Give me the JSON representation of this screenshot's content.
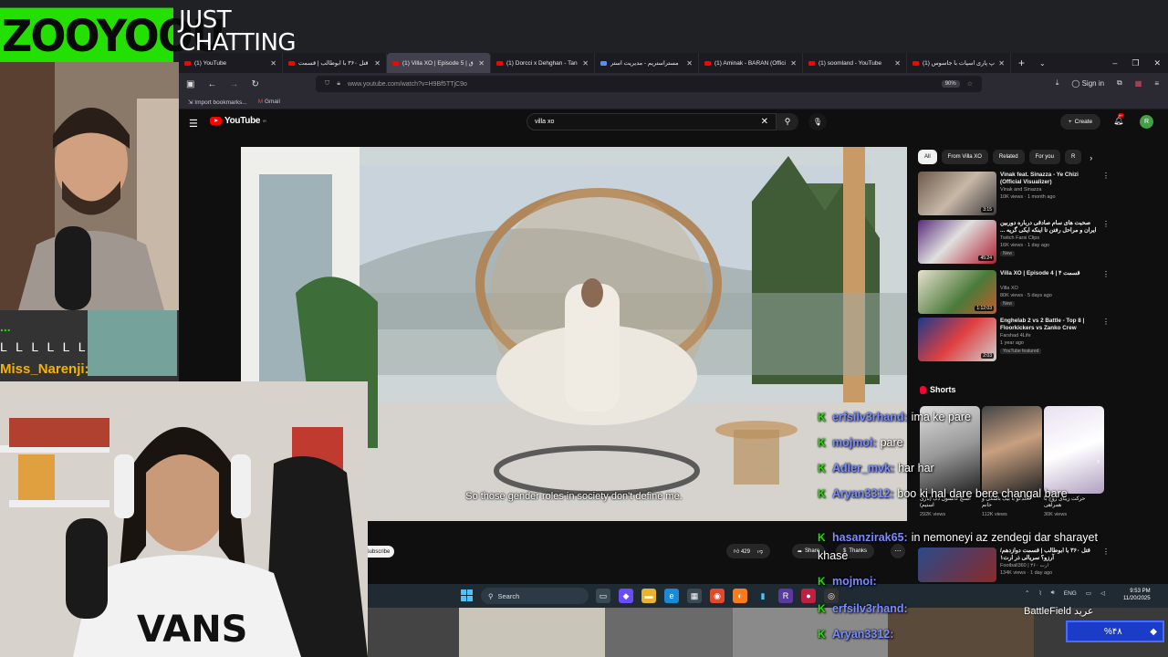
{
  "overlay": {
    "brand": "ZOOYOOU",
    "category_line1": "JUST",
    "category_line2": "CHATTING",
    "chat_strip": {
      "line1": "...",
      "line2": "L L L L L L",
      "line3": "Miss_Narenji:"
    }
  },
  "browser": {
    "tabs": [
      {
        "label": "(1) YouTube"
      },
      {
        "label": "قتل ۳۶۰ با ابوطالب | قسمت"
      },
      {
        "label": "(1) Villa XO | Episode 5 | ق"
      },
      {
        "label": "(1) Dorcci x Dehghan - Tan"
      },
      {
        "label": "مستراستریم - مدیریت استر"
      },
      {
        "label": "(1) Aminak - BARAN (Offici"
      },
      {
        "label": "(1) soomland - YouTube"
      },
      {
        "label": "(1) پ پاری اسپات با جاسوس"
      }
    ],
    "url": "www.youtube.com/watch?v=H9Bf5TTjC9o",
    "zoom": "90%",
    "sign_in": "Sign in",
    "bookmarks": [
      "Import bookmarks...",
      "Gmail"
    ]
  },
  "youtube": {
    "search_value": "villa xo",
    "create_label": "Create",
    "notif_count": "9+",
    "avatar_letter": "R",
    "subtitle": "So those gender roles in society don't define me.",
    "subscribe_label": "Subscribe",
    "like_count": "429",
    "share_label": "Share",
    "thanks_label": "Thanks",
    "chips": [
      "All",
      "From Villa XO",
      "Related",
      "For you",
      "R"
    ],
    "recommendations": [
      {
        "title": "Vinak feat. Sinazza - Ye Chizi (Official Visualizer)",
        "channel": "Vinak and Sinazza",
        "meta": "10K views · 1 month ago",
        "duration": "3:15",
        "badge": ""
      },
      {
        "title": "صحبت های سام صادقی درباره دوربین ایران و مراحل رفتن تا اینکه ایکی گریه ... | کوک ۴",
        "channel": "Twitch Farsi Clips",
        "meta": "16K views · 1 day ago",
        "duration": "45:24",
        "badge": "New"
      },
      {
        "title": "Villa XO | Episode 4 | قسمت ۴",
        "channel": "Villa XO",
        "meta": "80K views · 5 days ago",
        "duration": "1:12:03",
        "badge": "New"
      },
      {
        "title": "Enghelab 2 vs 2 Battle - Top 8 | Floorkickers vs Zanko Crew",
        "channel": "Farshad 4Life",
        "meta": "1 year ago",
        "duration": "2:03",
        "badge": "YouTube featured"
      }
    ],
    "shorts_heading": "Shorts",
    "shorts": [
      {
        "title": "اسنچ کانسول دک (بازی استیم)",
        "views": "292K views"
      },
      {
        "title": "گلدگو با بیگ باشگی و حانم",
        "views": "112K views"
      },
      {
        "title": "حرکت زیبای زوج با همراهی",
        "views": "30K views"
      }
    ],
    "extra_reco": {
      "title": "قتل ۳۶۰ با ابوطالب | قسمت دوازدهم/آرزو؟ سریالی ذر ارت۱",
      "channel": "Football360 | ۳۶۰ ارت",
      "meta": "134K views · 1 day ago"
    }
  },
  "taskbar": {
    "search_label": "Search",
    "lang": "ENG",
    "time": "9:53 PM",
    "date": "11/20/2025"
  },
  "chat": [
    {
      "user": "erfsilv3rhand:",
      "msg": "ima ke pare"
    },
    {
      "user": "mojmoi:",
      "msg": "pare"
    },
    {
      "user": "Adler_mvk:",
      "msg": "har har"
    },
    {
      "user": "Aryan3312:",
      "msg": "boo ki hal dare bere changal bare"
    },
    {
      "user": "hasanzirak65:",
      "msg": "in nemoneyi az zendegi dar sharayet"
    },
    {
      "user": "",
      "msg": "khase"
    },
    {
      "user": "mojmoi:",
      "msg": ""
    },
    {
      "user": "erfsilv3rhand:",
      "msg": ""
    },
    {
      "user": "Aryan3312:",
      "msg": ""
    }
  ],
  "battle": {
    "label": "BattleField عرید",
    "value": "%۴۸"
  },
  "colors": {
    "brand_green": "#23e000",
    "yt_red": "#ff0000",
    "chat_user": "#7b8cff"
  }
}
